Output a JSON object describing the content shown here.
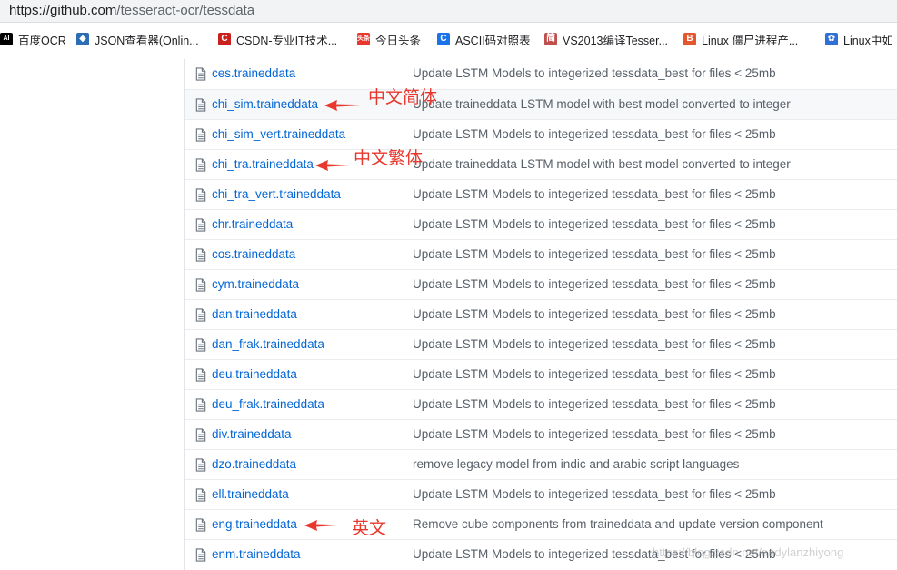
{
  "address_bar": {
    "host": "https://github.com",
    "path": "/tesseract-ocr/tessdata"
  },
  "bookmarks": [
    {
      "icon": "ai-icon",
      "glyph": "AI",
      "color": "#000000",
      "label": "百度OCR"
    },
    {
      "icon": "json-icon",
      "glyph": "◆",
      "color": "#2d6db5",
      "label": "JSON查看器(Onlin..."
    },
    {
      "icon": "csdn-icon",
      "glyph": "C",
      "color": "#c9211e",
      "label": "CSDN-专业IT技术..."
    },
    {
      "icon": "toutiao-icon",
      "glyph": "头条",
      "color": "#e8372d",
      "label": "今日头条"
    },
    {
      "icon": "ascii-icon",
      "glyph": "C",
      "color": "#1a73e8",
      "label": "ASCII码对照表"
    },
    {
      "icon": "jian-icon",
      "glyph": "简",
      "color": "#c0504d",
      "label": "VS2013编译Tesser..."
    },
    {
      "icon": "bootstrap-icon",
      "glyph": "B",
      "color": "#e4572e",
      "label": "Linux 僵尸进程产..."
    },
    {
      "icon": "baidu-paw-icon",
      "glyph": "✿",
      "color": "#2f6fd6",
      "label": "Linux中如"
    }
  ],
  "files": [
    {
      "name": "ces.traineddata",
      "message": "Update LSTM Models to integerized tessdata_best for files < 25mb"
    },
    {
      "name": "chi_sim.traineddata",
      "message": "Update traineddata LSTM model with best model converted to integer"
    },
    {
      "name": "chi_sim_vert.traineddata",
      "message": "Update LSTM Models to integerized tessdata_best for files < 25mb"
    },
    {
      "name": "chi_tra.traineddata",
      "message": "Update traineddata LSTM model with best model converted to integer"
    },
    {
      "name": "chi_tra_vert.traineddata",
      "message": "Update LSTM Models to integerized tessdata_best for files < 25mb"
    },
    {
      "name": "chr.traineddata",
      "message": "Update LSTM Models to integerized tessdata_best for files < 25mb"
    },
    {
      "name": "cos.traineddata",
      "message": "Update LSTM Models to integerized tessdata_best for files < 25mb"
    },
    {
      "name": "cym.traineddata",
      "message": "Update LSTM Models to integerized tessdata_best for files < 25mb"
    },
    {
      "name": "dan.traineddata",
      "message": "Update LSTM Models to integerized tessdata_best for files < 25mb"
    },
    {
      "name": "dan_frak.traineddata",
      "message": "Update LSTM Models to integerized tessdata_best for files < 25mb"
    },
    {
      "name": "deu.traineddata",
      "message": "Update LSTM Models to integerized tessdata_best for files < 25mb"
    },
    {
      "name": "deu_frak.traineddata",
      "message": "Update LSTM Models to integerized tessdata_best for files < 25mb"
    },
    {
      "name": "div.traineddata",
      "message": "Update LSTM Models to integerized tessdata_best for files < 25mb"
    },
    {
      "name": "dzo.traineddata",
      "message": "remove legacy model from indic and arabic script languages"
    },
    {
      "name": "ell.traineddata",
      "message": "Update LSTM Models to integerized tessdata_best for files < 25mb"
    },
    {
      "name": "eng.traineddata",
      "message": "Remove cube components from traineddata and update version component"
    },
    {
      "name": "enm.traineddata",
      "message": "Update LSTM Models to integerized tessdata_best for files < 25mb"
    }
  ],
  "hover_row": 1,
  "annotations": [
    {
      "row": 1,
      "text": "中文简体"
    },
    {
      "row": 3,
      "text": "中文繁体"
    },
    {
      "row": 15,
      "text": "英文"
    }
  ],
  "annotation_color": "#e8372d",
  "watermark": "https://blog.csdn.net/andylanzhiyong"
}
